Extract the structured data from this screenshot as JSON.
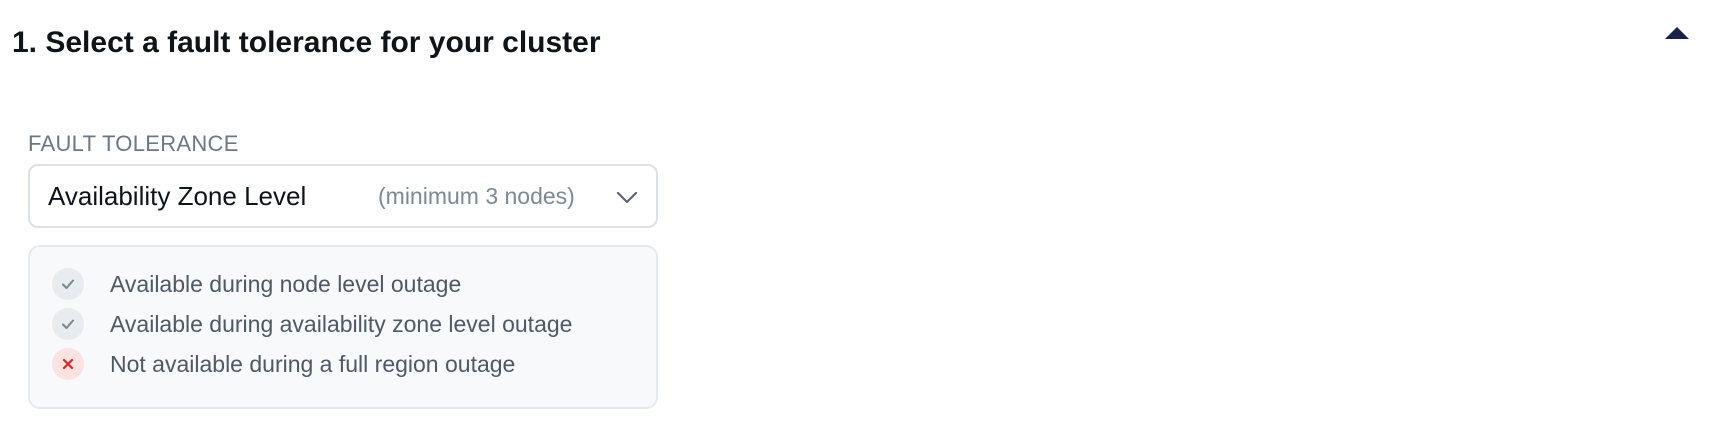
{
  "section": {
    "title": "1. Select a fault tolerance for your cluster",
    "toggle_icon": "caret-up-icon",
    "toggle_state": "expanded"
  },
  "fault_tolerance": {
    "label": "FAULT TOLERANCE",
    "selected_value": "Availability Zone Level",
    "selected_hint": "(minimum 3 nodes)",
    "dropdown_icon": "chevron-down-icon"
  },
  "features": [
    {
      "text": "Available during node level outage",
      "status": "available",
      "icon": "check-icon"
    },
    {
      "text": "Available during availability zone level outage",
      "status": "available",
      "icon": "check-icon"
    },
    {
      "text": "Not available during a full region outage",
      "status": "unavailable",
      "icon": "x-icon"
    }
  ],
  "colors": {
    "title": "#0f1419",
    "toggle": "#14234b",
    "label": "#6b7785",
    "available_icon": "#7a8592",
    "unavailable_icon": "#d62828",
    "unavailable_bg": "#fde2e2"
  }
}
